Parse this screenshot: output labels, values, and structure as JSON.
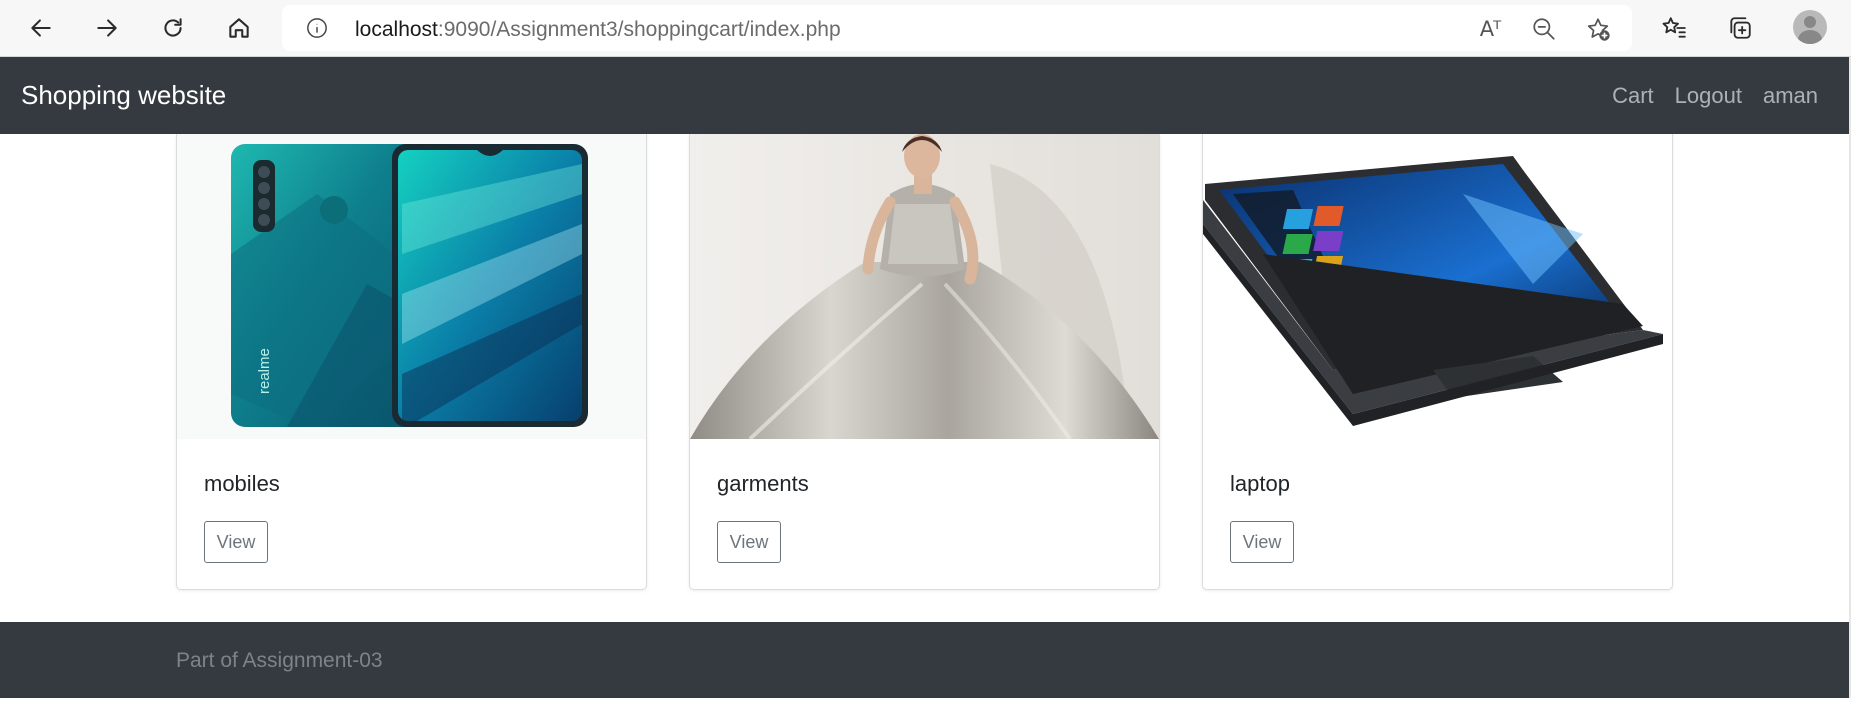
{
  "browser": {
    "url_host": "localhost",
    "url_rest": ":9090/Assignment3/shoppingcart/index.php",
    "read_aloud_glyph": "Aᵀ",
    "icons": [
      "back-icon",
      "forward-icon",
      "refresh-icon",
      "home-icon",
      "info-icon",
      "read-aloud-icon",
      "zoom-out-icon",
      "add-favorite-icon",
      "favorites-icon",
      "collections-icon",
      "profile-icon"
    ]
  },
  "navbar": {
    "brand": "Shopping website",
    "links": [
      "Cart",
      "Logout",
      "aman"
    ]
  },
  "products": [
    {
      "name": "mobiles",
      "button": "View",
      "image": "phone-image"
    },
    {
      "name": "garments",
      "button": "View",
      "image": "gown-image"
    },
    {
      "name": "laptop",
      "button": "View",
      "image": "laptop-image"
    }
  ],
  "footer": {
    "text": "Part of Assignment-03"
  },
  "colors": {
    "navbar": "#343a40",
    "link": "rgba(255,255,255,0.6)",
    "button_border": "#6c757d"
  }
}
